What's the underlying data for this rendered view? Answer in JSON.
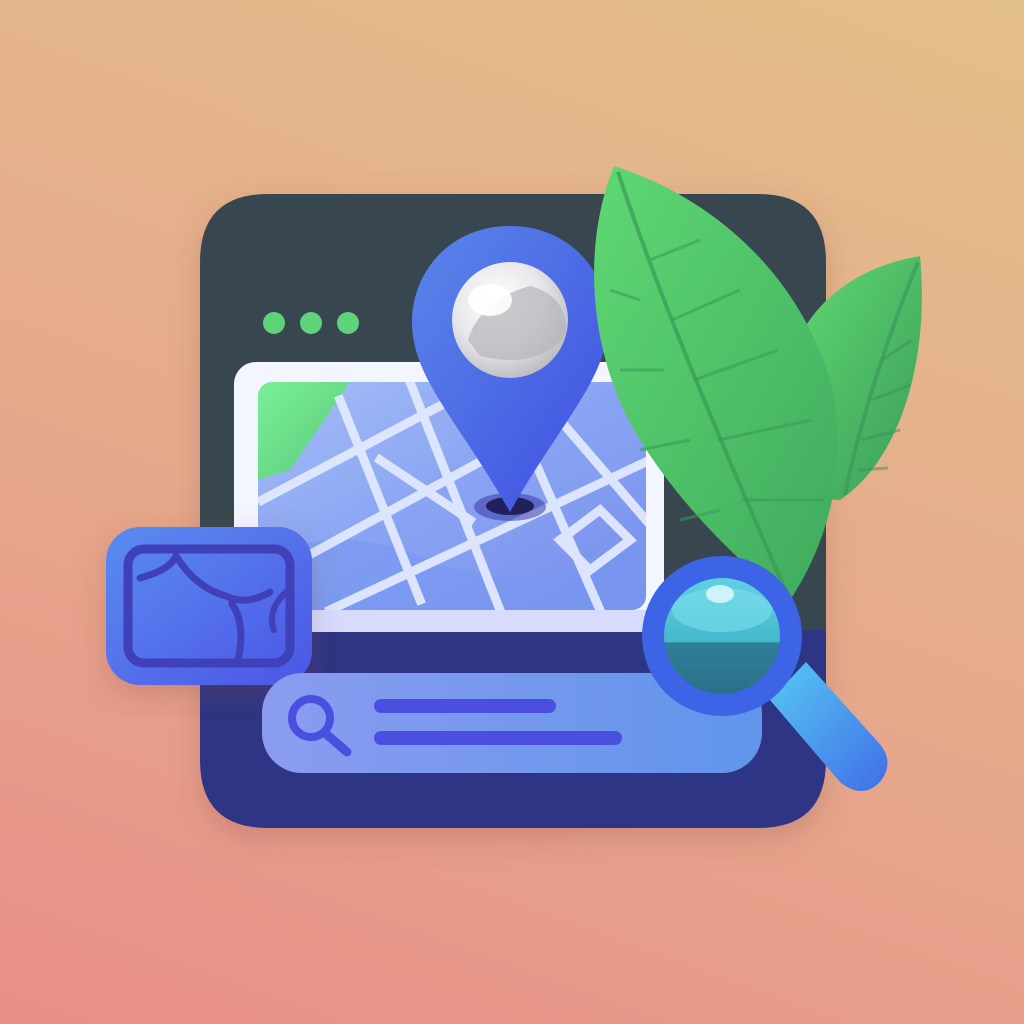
{
  "icons": {
    "app_window": "browser-window-icon",
    "window_dots": "window-control-dots",
    "map": "city-map-icon",
    "location_pin": "location-pin-icon",
    "map_card": "map-card-icon",
    "search": "search-icon",
    "magnifier": "magnifying-glass-icon",
    "leaves": "leaf-icon"
  },
  "colors": {
    "background_top": "#e3bf8a",
    "background_bottom": "#e98e88",
    "window_frame": "#37474f",
    "window_dots": "#5fd27a",
    "window_bottom": "#2e3584",
    "map_blue": "#7f9cf2",
    "map_green": "#6ce68a",
    "pin_blue": "#4a63e6",
    "search_bar": "#6d86ea",
    "search_lines": "#4a4fe0",
    "leaf_green": "#4fbf66",
    "magnifier_rim": "#3d63e6",
    "magnifier_glass": "#45b8cc"
  }
}
